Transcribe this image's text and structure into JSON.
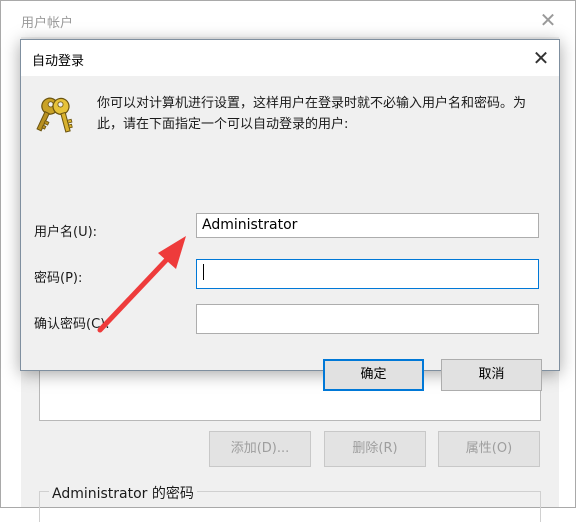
{
  "background_window": {
    "title": "用户帐户",
    "close_glyph": "✕",
    "buttons": [
      "添加(D)...",
      "删除(R)",
      "属性(O)"
    ],
    "group_label": "Administrator 的密码"
  },
  "dialog": {
    "title": "自动登录",
    "close_glyph": "✕",
    "description": "你可以对计算机进行设置，这样用户在登录时就不必输入用户名和密码。为此，请在下面指定一个可以自动登录的用户:",
    "icon": "keys-icon",
    "fields": {
      "username": {
        "label": "用户名(U):",
        "value": "Administrator"
      },
      "password": {
        "label": "密码(P):",
        "value": ""
      },
      "confirm": {
        "label": "确认密码(C):",
        "value": ""
      }
    },
    "ok_label": "确定",
    "cancel_label": "取消"
  },
  "annotation": {
    "arrow_color": "#ee3b3b"
  },
  "colors": {
    "focus_border": "#0078d7",
    "dialog_body": "#f0f0f0"
  }
}
